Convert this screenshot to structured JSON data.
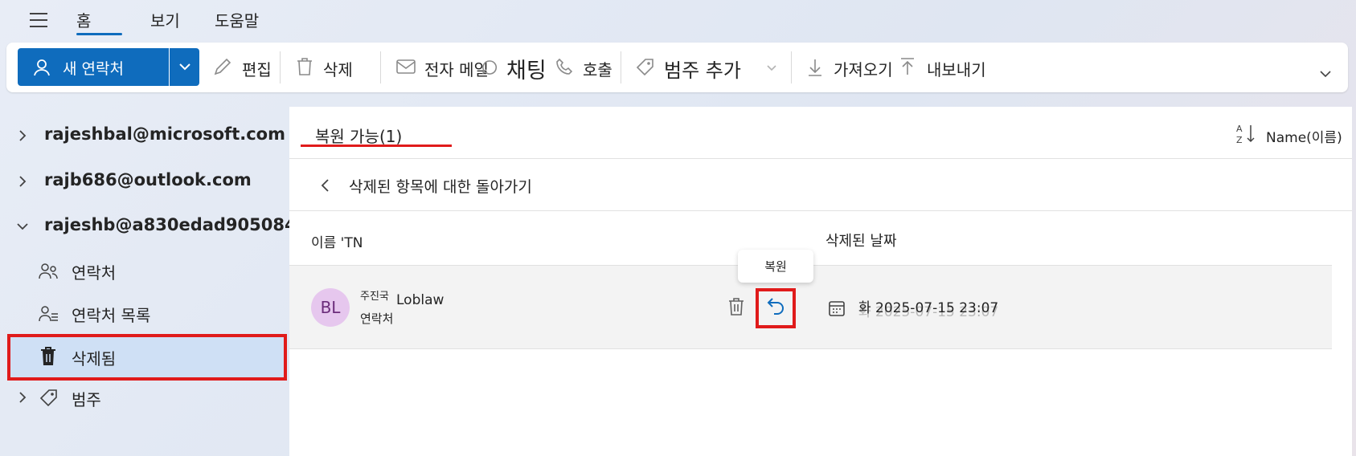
{
  "menu": {
    "tabs": [
      "홈",
      "보기",
      "도움말"
    ]
  },
  "ribbon": {
    "new_contact": "새 연락처",
    "edit": "편집",
    "delete": "삭제",
    "email": "전자 메일",
    "chat": "채팅",
    "call": "호출",
    "add_category": "범주 추가",
    "import": "가져오기",
    "export": "내보내기"
  },
  "sidebar": {
    "accounts": [
      "rajeshbal@microsoft.com",
      "rajb686@outlook.com",
      "rajeshb@a830edad9050849..."
    ],
    "items": {
      "contacts": "연락처",
      "contact_lists": "연락처 목록",
      "deleted": "삭제됨",
      "categories": "범주"
    }
  },
  "main": {
    "tab_label": "복원 가능(1)",
    "sort_label": "Name(이름)",
    "back_label": "삭제된 항목에 대한 돌아가기",
    "columns": {
      "name": "이름 'TN",
      "deleted_date": "삭제된 날짜"
    },
    "row": {
      "initials": "BL",
      "prefix": "주진국",
      "name": "Loblaw",
      "type": "연락처",
      "date": "화 2025-07-15 23:07",
      "date_ghost": "화 2025-07-15 23:07"
    },
    "tooltip": "복원"
  },
  "colors": {
    "accent": "#0f6cbd",
    "highlight_red": "#e01b1b",
    "selected_bg": "#cfe0f5",
    "avatar_bg": "#e6c7ee"
  }
}
